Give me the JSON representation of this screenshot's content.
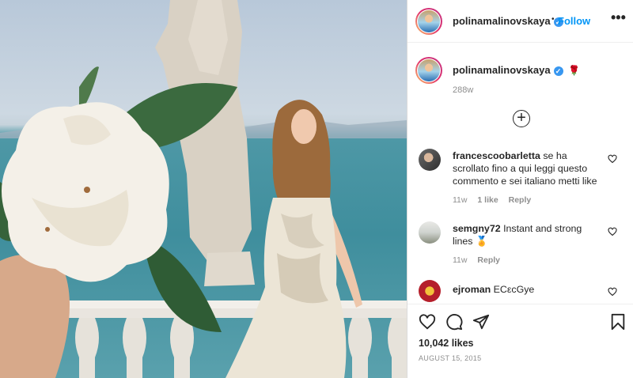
{
  "post": {
    "author": "polinamalinovskaya",
    "follow_label": "Follow",
    "separator": "•",
    "more_icon": "•••",
    "caption_emoji": "🌹",
    "caption_time": "288w",
    "load_more_icon": "+",
    "likes": "10,042 likes",
    "date": "AUGUST 15, 2015"
  },
  "comments": [
    {
      "user": "francescoobarletta",
      "text": "se ha scrollato fino a qui leggi questo commento e sei italiano metti like",
      "time": "11w",
      "likes": "1 like",
      "reply": "Reply"
    },
    {
      "user": "semgny72",
      "text": "Instant and strong lines",
      "emoji": "🏅",
      "time": "11w",
      "reply": "Reply"
    },
    {
      "user": "ejroman",
      "text": "ECεcGye"
    }
  ],
  "colors": {
    "link_blue": "#0095f6",
    "verified_blue": "#3897f0",
    "text": "#262626",
    "muted": "#8e8e8e"
  },
  "icons": [
    "heart-icon",
    "comment-icon",
    "share-icon",
    "bookmark-icon",
    "verified-badge-icon",
    "more-options-icon",
    "plus-circle-icon"
  ]
}
